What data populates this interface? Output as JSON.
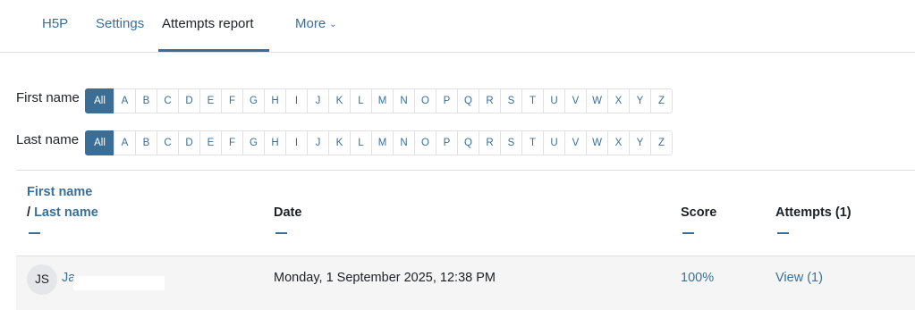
{
  "tabs": [
    {
      "label": "H5P"
    },
    {
      "label": "Settings"
    },
    {
      "label": "Attempts report"
    },
    {
      "label": "More"
    }
  ],
  "filters": {
    "first_name_label": "First name",
    "last_name_label": "Last name",
    "all_label": "All",
    "letters": [
      "A",
      "B",
      "C",
      "D",
      "E",
      "F",
      "G",
      "H",
      "I",
      "J",
      "K",
      "L",
      "M",
      "N",
      "O",
      "P",
      "Q",
      "R",
      "S",
      "T",
      "U",
      "V",
      "W",
      "X",
      "Y",
      "Z"
    ]
  },
  "table": {
    "headers": {
      "first_name": "First name",
      "slash": "/",
      "last_name": "Last name",
      "date": "Date",
      "score": "Score",
      "attempts": "Attempts (1)"
    },
    "rows": [
      {
        "initials": "JS",
        "name": "Ja",
        "date": "Monday, 1 September 2025, 12:38 PM",
        "score": "100%",
        "view": "View (1)"
      }
    ]
  },
  "colors": {
    "accent": "#3b6e96",
    "link": "#3a6f9a"
  }
}
